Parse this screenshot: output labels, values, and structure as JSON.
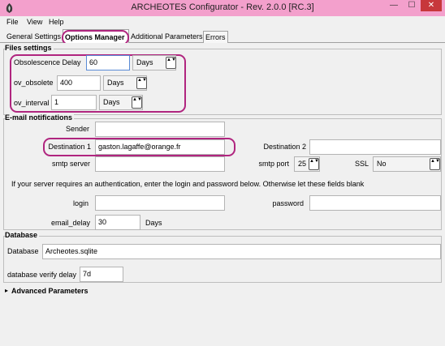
{
  "window": {
    "title": "ARCHEOTES Configurator - Rev. 2.0.0 [RC.3]",
    "min": "—",
    "max": "☐",
    "close": "✕"
  },
  "menu": {
    "file": "File",
    "view": "View",
    "help": "Help"
  },
  "tabs": {
    "general": "General Settings",
    "options": "Options Manager",
    "additional": "Additional Parameters",
    "errors": "Errors"
  },
  "files": {
    "title": "Files settings",
    "obsolescence_label": "Obsolescence Delay",
    "obsolescence_value": "60",
    "obsolescence_unit": "Days",
    "ov_obsolete_label": "ov_obsolete",
    "ov_obsolete_value": "400",
    "ov_obsolete_unit": "Days",
    "ov_interval_label": "ov_interval",
    "ov_interval_value": "1",
    "ov_interval_unit": "Days"
  },
  "email": {
    "title": "E-mail notifications",
    "sender_label": "Sender",
    "sender_value": "",
    "dest1_label": "Destination 1",
    "dest1_value": "gaston.lagaffe@orange.fr",
    "dest2_label": "Destination 2",
    "dest2_value": "",
    "smtp_server_label": "smtp server",
    "smtp_server_value": "",
    "smtp_port_label": "smtp port",
    "smtp_port_value": "25",
    "ssl_label": "SSL",
    "ssl_value": "No",
    "auth_info": "If your server requires an authentication, enter the login and password below. Otherwise let these fields blank",
    "login_label": "login",
    "login_value": "",
    "password_label": "password",
    "password_value": "",
    "delay_label": "email_delay",
    "delay_value": "30",
    "delay_unit": "Days"
  },
  "database": {
    "title": "Database",
    "db_label": "Database",
    "db_value": "Archeotes.sqlite",
    "verify_label": "database verify delay",
    "verify_value": "7d"
  },
  "advanced": {
    "label": "Advanced Parameters"
  },
  "icons": {
    "spin": "▲▼",
    "expander": "▸"
  }
}
